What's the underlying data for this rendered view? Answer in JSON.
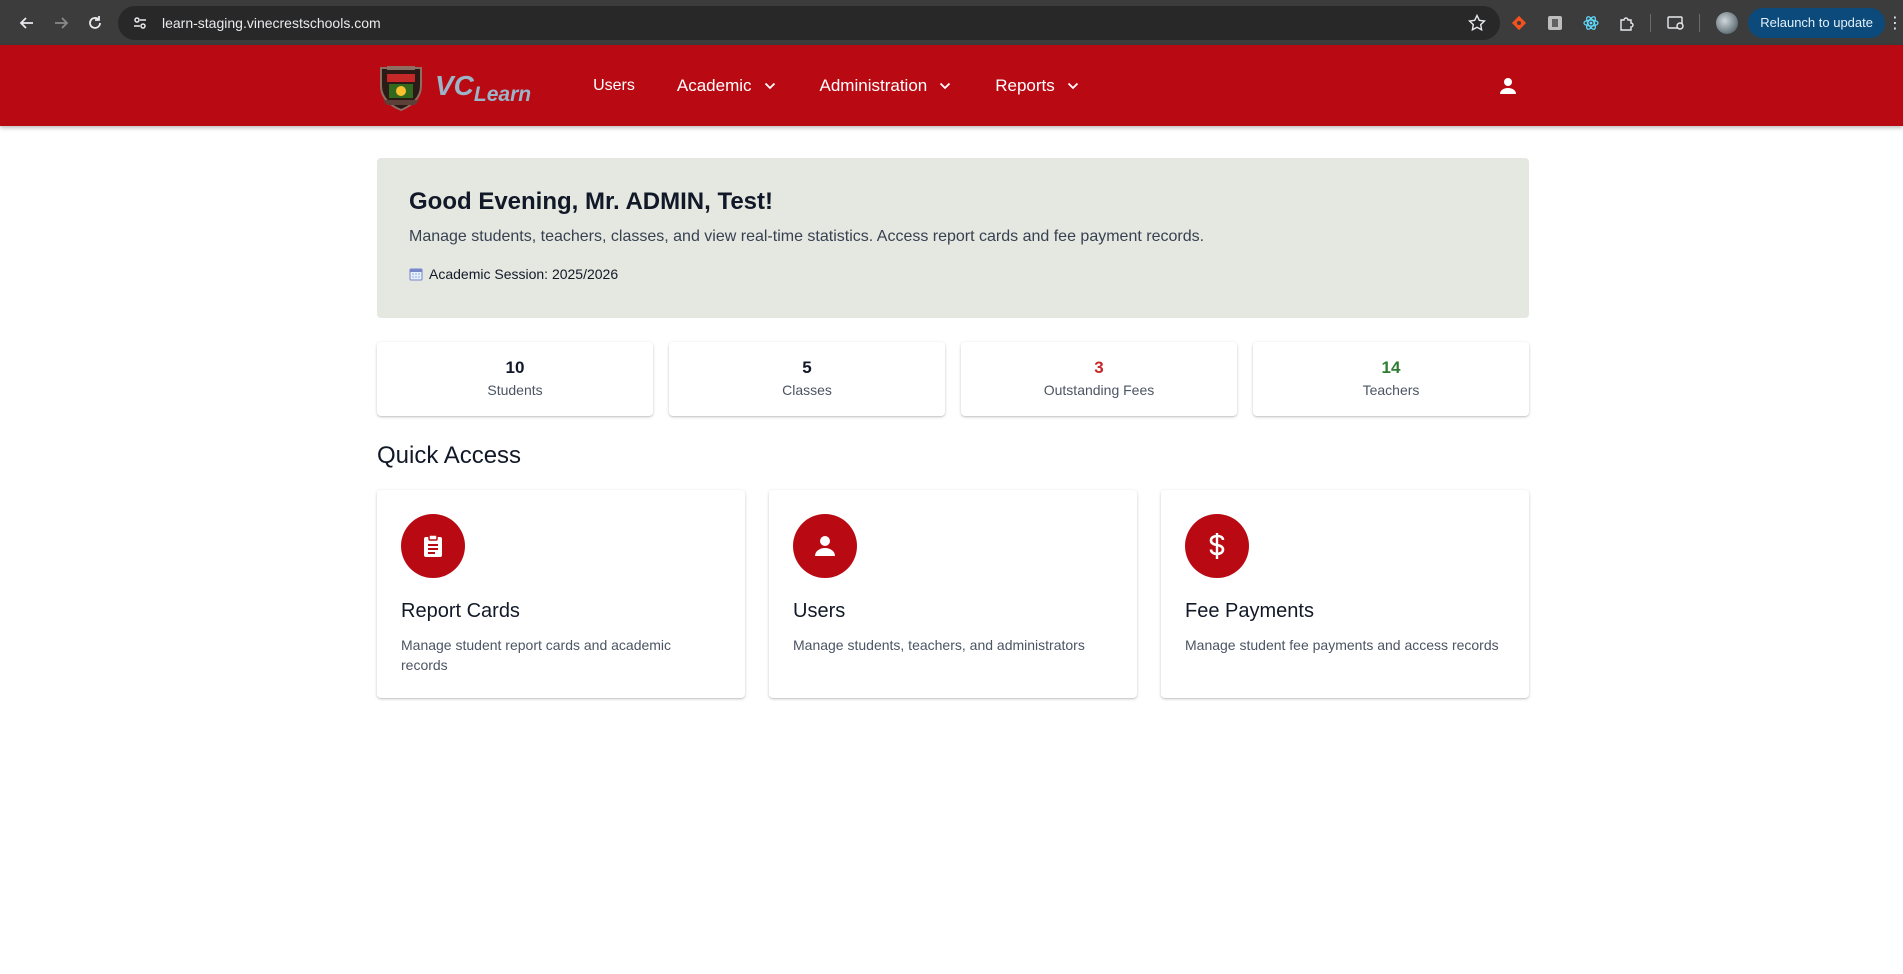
{
  "browser": {
    "url": "learn-staging.vinecrestschools.com",
    "relaunch_label": "Relaunch to update"
  },
  "header": {
    "brand_vc": "VC",
    "brand_learn": "Learn",
    "nav": [
      {
        "label": "Users"
      },
      {
        "label": "Academic"
      },
      {
        "label": "Administration"
      },
      {
        "label": "Reports"
      }
    ]
  },
  "welcome": {
    "greeting": "Good Evening, Mr. ADMIN, Test!",
    "description": "Manage students, teachers, classes, and view real-time statistics. Access report cards and fee payment records.",
    "session": "Academic Session: 2025/2026"
  },
  "stats": [
    {
      "value": "10",
      "label": "Students",
      "color": "#111827"
    },
    {
      "value": "5",
      "label": "Classes",
      "color": "#111827"
    },
    {
      "value": "3",
      "label": "Outstanding Fees",
      "color": "#c62828"
    },
    {
      "value": "14",
      "label": "Teachers",
      "color": "#2e7d32"
    }
  ],
  "quick_access": {
    "title": "Quick Access",
    "cards": [
      {
        "icon": "clipboard-icon",
        "title": "Report Cards",
        "description": "Manage student report cards and academic records"
      },
      {
        "icon": "person-icon",
        "title": "Users",
        "description": "Manage students, teachers, and administrators"
      },
      {
        "icon": "dollar-icon",
        "title": "Fee Payments",
        "description": "Manage student fee payments and access records"
      }
    ]
  },
  "colors": {
    "brand_red": "#b90a14",
    "welcome_bg": "#e5e8e0"
  }
}
